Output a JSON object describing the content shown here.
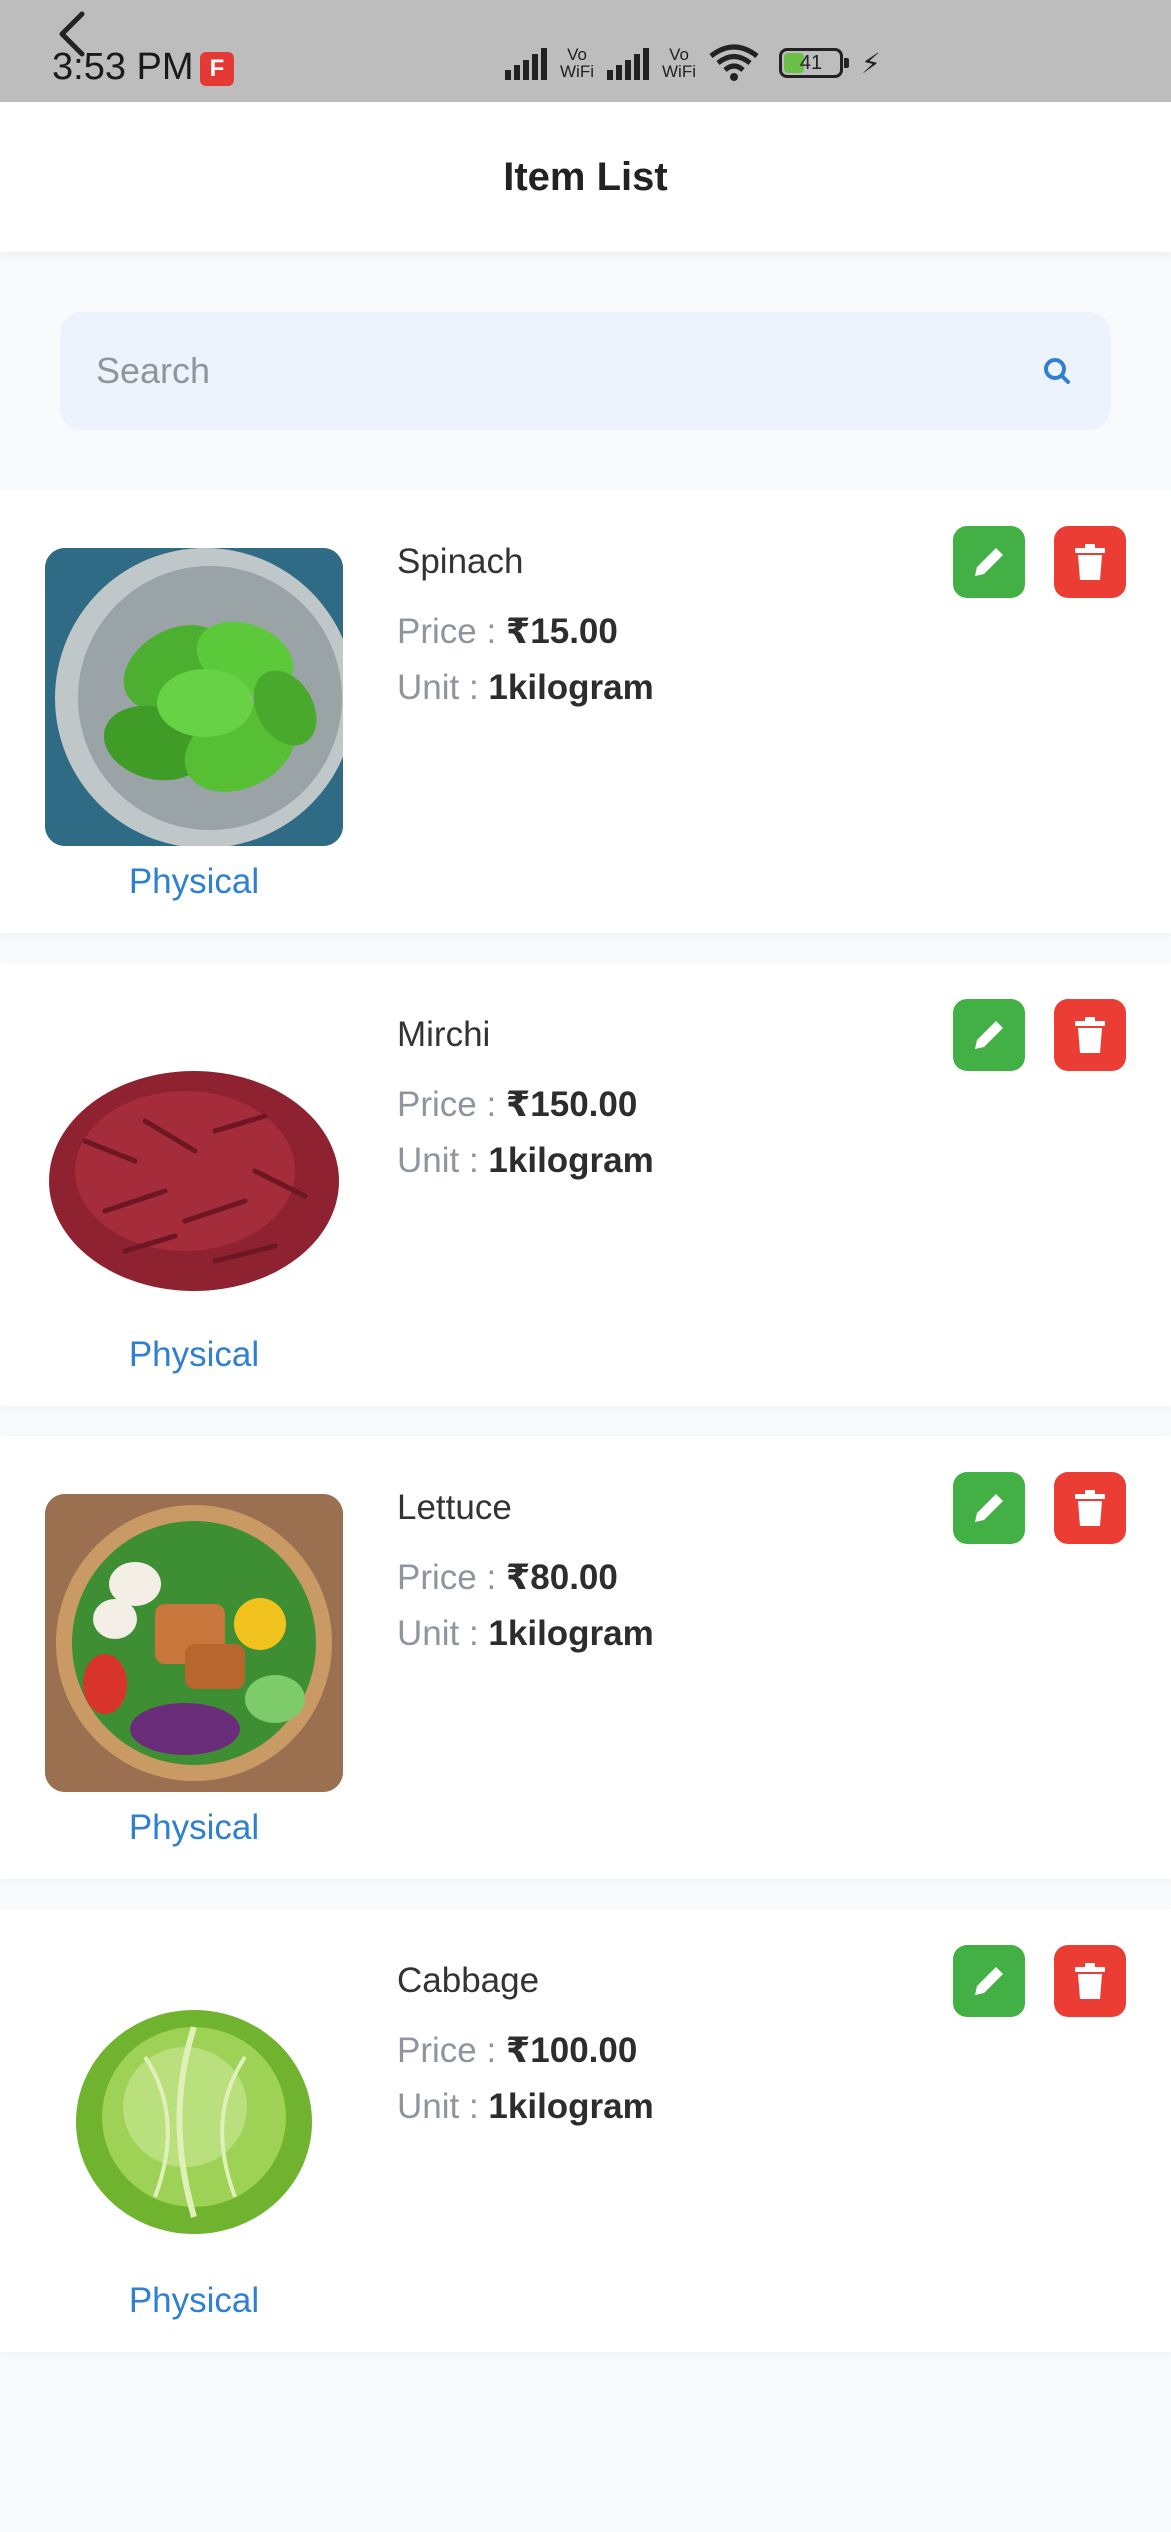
{
  "status_bar": {
    "time": "3:53 PM",
    "vowifi_1": "Vo WiFi",
    "vowifi_2": "Vo WiFi",
    "battery": "41"
  },
  "header": {
    "title": "Item List"
  },
  "search": {
    "placeholder": "Search"
  },
  "labels": {
    "price": "Price : ",
    "unit": "Unit : "
  },
  "items": [
    {
      "name": "Spinach",
      "price": "₹15.00",
      "unit": "1kilogram",
      "type": "Physical",
      "image": "spinach-image"
    },
    {
      "name": "Mirchi",
      "price": "₹150.00",
      "unit": "1kilogram",
      "type": "Physical",
      "image": "mirchi-image"
    },
    {
      "name": "Lettuce",
      "price": "₹80.00",
      "unit": "1kilogram",
      "type": "Physical",
      "image": "lettuce-image"
    },
    {
      "name": "Cabbage",
      "price": "₹100.00",
      "unit": "1kilogram",
      "type": "Physical",
      "image": "cabbage-image"
    }
  ],
  "colors": {
    "edit": "#43b046",
    "delete": "#ec3d35",
    "link_blue": "#2f80d1",
    "search_bg": "#edf3fc"
  },
  "battery_level": 0.41
}
